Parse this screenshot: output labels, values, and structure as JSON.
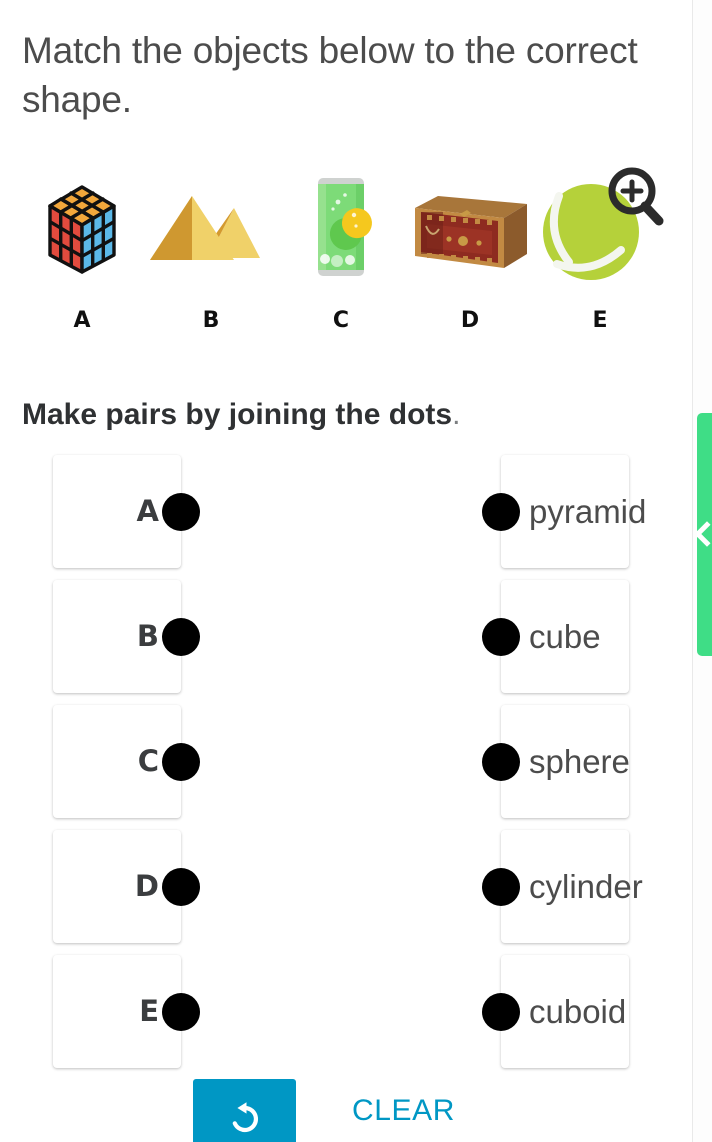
{
  "prompt": {
    "text": "Match the objects below to the correct shape."
  },
  "objects": {
    "items": [
      {
        "label": "A",
        "icon": "rubiks-cube-icon",
        "name": "rubiks cube"
      },
      {
        "label": "B",
        "icon": "pyramids-icon",
        "name": "pyramids"
      },
      {
        "label": "C",
        "icon": "soda-can-icon",
        "name": "soda can"
      },
      {
        "label": "D",
        "icon": "treasure-chest-icon",
        "name": "treasure chest"
      },
      {
        "label": "E",
        "icon": "tennis-ball-icon",
        "name": "tennis ball"
      }
    ]
  },
  "pairs_section": {
    "heading": "Make pairs by joining the dots",
    "heading_period": ".",
    "left_column": [
      {
        "label": "A"
      },
      {
        "label": "B"
      },
      {
        "label": "C"
      },
      {
        "label": "D"
      },
      {
        "label": "E"
      }
    ],
    "right_column": [
      {
        "label": "pyramid"
      },
      {
        "label": "cube"
      },
      {
        "label": "sphere"
      },
      {
        "label": "cylinder"
      },
      {
        "label": "cuboid"
      }
    ]
  },
  "footer": {
    "undo_icon": "undo-arrow-icon",
    "clear_label": "CLEAR"
  },
  "side_tab": {
    "icon": "chevron-left-icon"
  },
  "colors": {
    "accent_cyan": "#0097c4",
    "tab_green": "#3fdd86",
    "dot_black": "#000000",
    "text_gray": "#4c4c4c",
    "heading_dark": "#2f3133"
  }
}
